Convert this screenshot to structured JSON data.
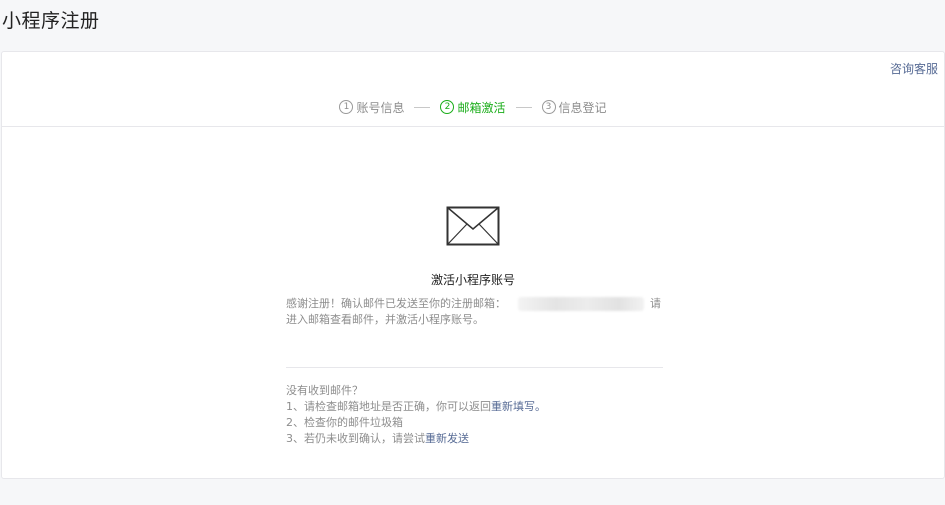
{
  "page": {
    "title": "小程序注册"
  },
  "header": {
    "support_link": "咨询客服"
  },
  "steps": [
    {
      "num": "1",
      "label": "账号信息",
      "active": false
    },
    {
      "num": "2",
      "label": "邮箱激活",
      "active": true
    },
    {
      "num": "3",
      "label": "信息登记",
      "active": false
    }
  ],
  "main": {
    "icon": "envelope-icon",
    "heading": "激活小程序账号",
    "desc_prefix": "感谢注册！确认邮件已发送至你的注册邮箱：",
    "desc_suffix": "请进入邮箱查看邮件，并激活小程序账号。"
  },
  "help": {
    "title": "没有收到邮件？",
    "item1_text": "1、请检查邮箱地址是否正确，你可以返回",
    "item1_link": "重新填写。",
    "item2_text": "2、检查你的邮件垃圾箱",
    "item3_text": "3、若仍未收到确认，请尝试",
    "item3_link": "重新发送"
  },
  "colors": {
    "accent": "#1aad19",
    "link": "#576b95",
    "muted": "#8d8d8d"
  }
}
